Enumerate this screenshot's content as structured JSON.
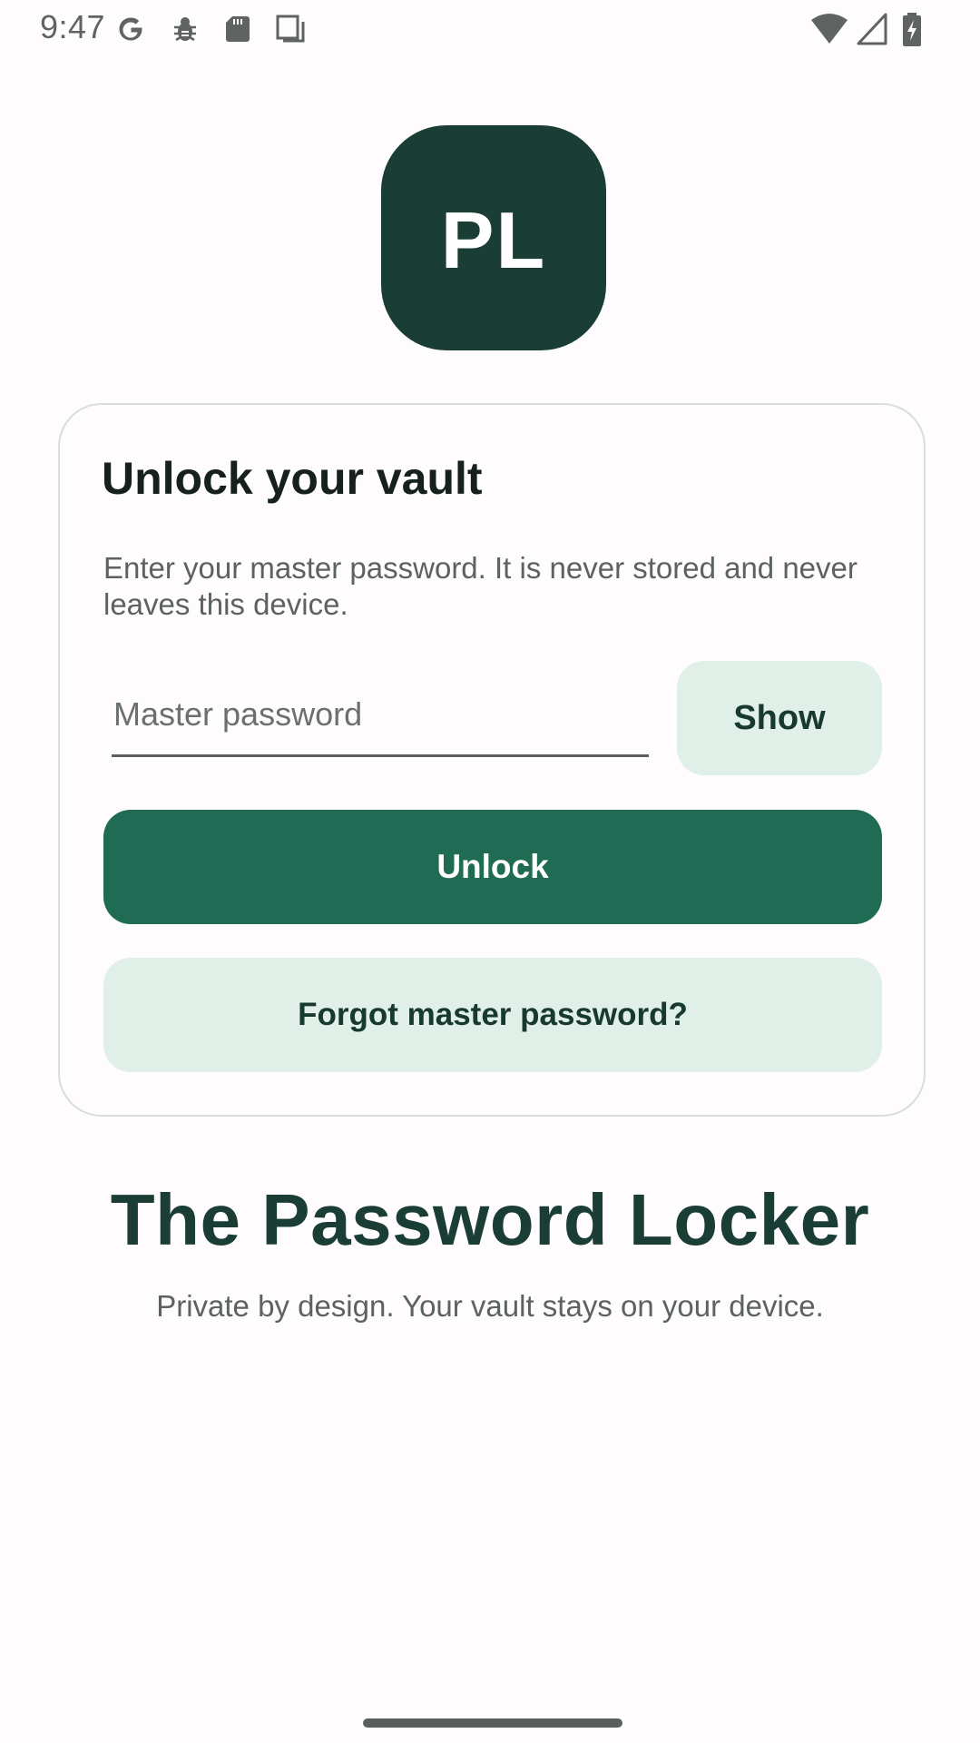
{
  "status_bar": {
    "time": "9:47",
    "left_icons": [
      "google-icon",
      "bug-icon",
      "sd-card-icon",
      "screenshot-icon"
    ],
    "right_icons": [
      "wifi-icon",
      "cell-signal-icon",
      "battery-charging-icon"
    ]
  },
  "logo": {
    "text": "PL",
    "color": "#1a3d35"
  },
  "card": {
    "title": "Unlock your vault",
    "description": "Enter your master password. It is never stored and never leaves this device.",
    "password_field": {
      "placeholder": "Master password",
      "value": ""
    },
    "show_label": "Show",
    "unlock_label": "Unlock",
    "forgot_label": "Forgot master password?"
  },
  "footer": {
    "app_name": "The Password Locker",
    "tagline": "Private by design. Your vault stays on your device."
  },
  "colors": {
    "primary": "#206b53",
    "primary_dark": "#1a3d35",
    "tonal": "#e0efe8",
    "background": "#fefcfc"
  }
}
